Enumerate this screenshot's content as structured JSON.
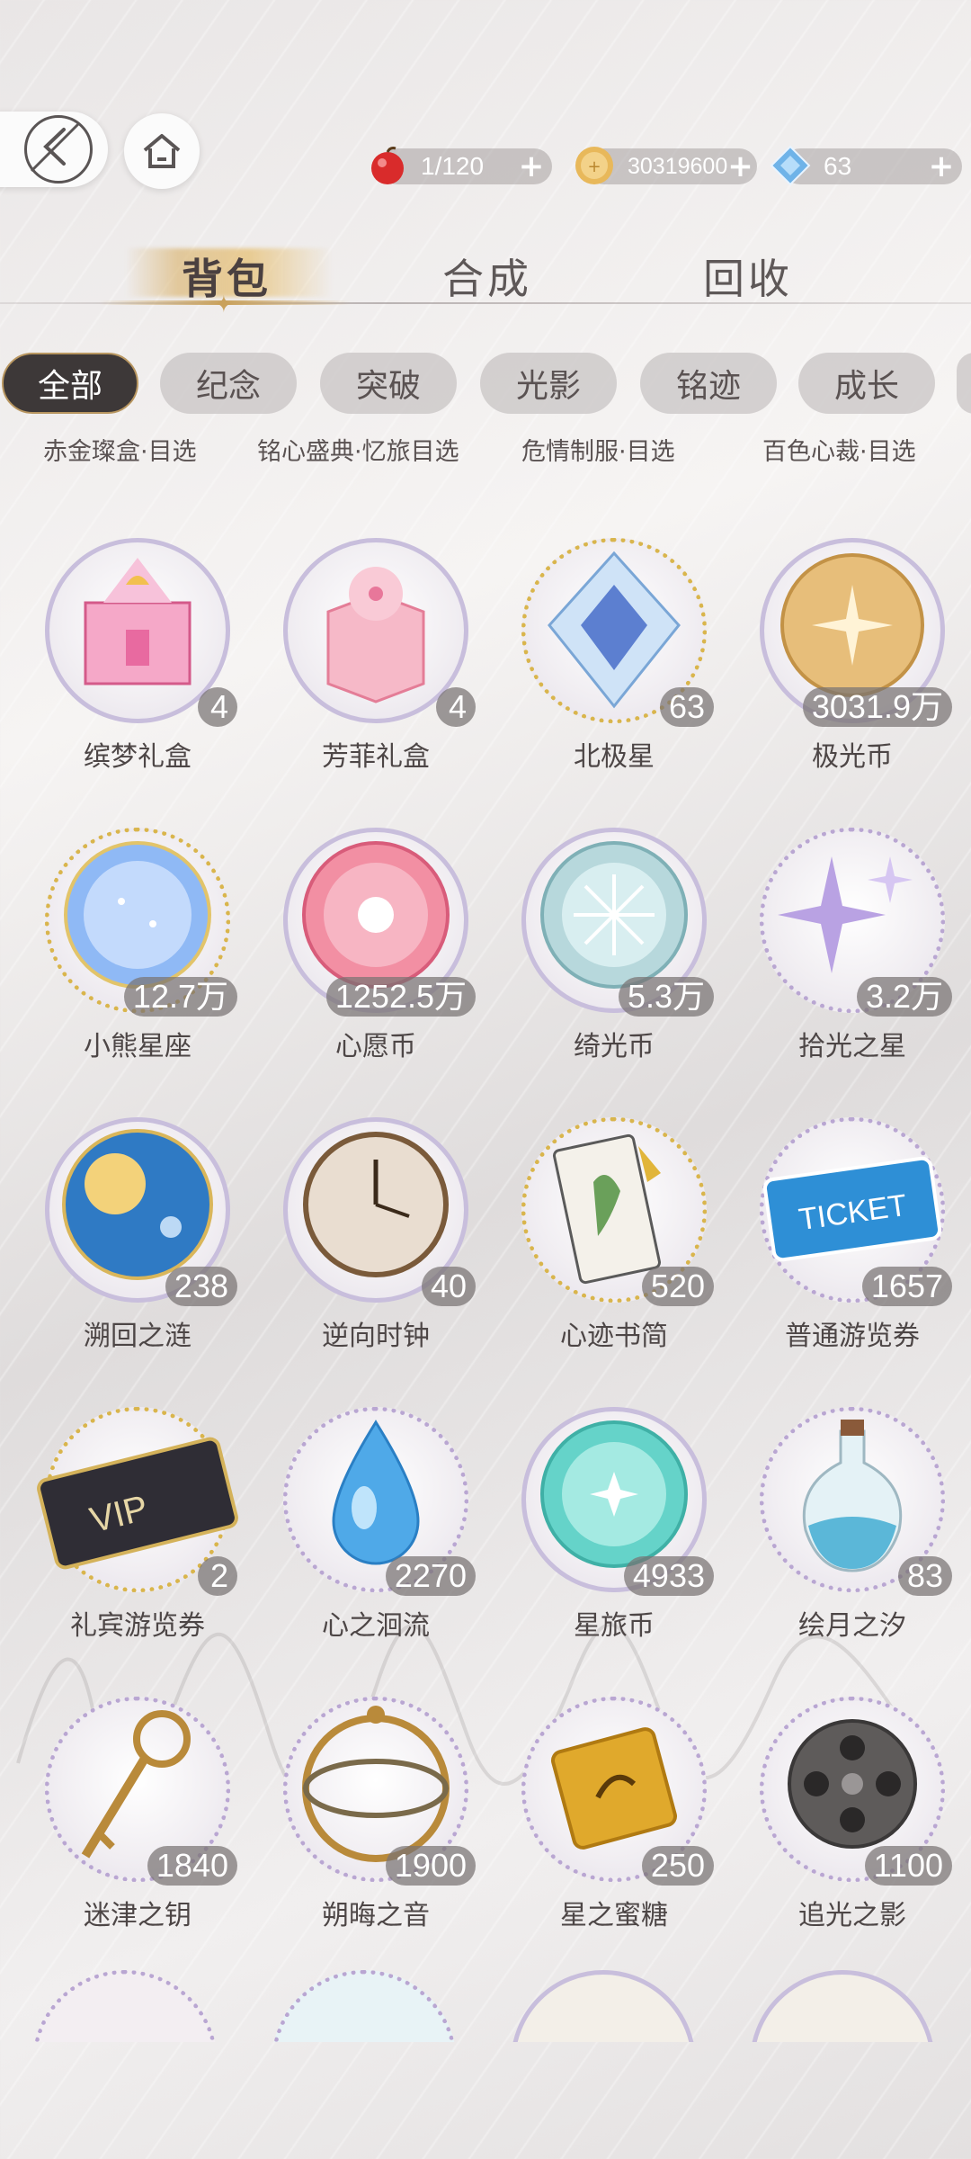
{
  "resources": {
    "stamina": {
      "value": "1/120",
      "icon": "red-apple-icon"
    },
    "coins": {
      "value": "30319600",
      "icon": "gold-coin-icon"
    },
    "gems": {
      "value": "63",
      "icon": "blue-diamond-icon"
    },
    "plus": "+"
  },
  "main_tabs": [
    "背包",
    "合成",
    "回收"
  ],
  "filter_chips": [
    "全部",
    "纪念",
    "突破",
    "光影",
    "铭迹",
    "成长"
  ],
  "subtitles": [
    "赤金璨盒·目选",
    "铭心盛典·忆旅目选",
    "危情制服·目选",
    "百色心裁·目选"
  ],
  "items": [
    {
      "name": "缤梦礼盒",
      "count": "4"
    },
    {
      "name": "芳菲礼盒",
      "count": "4"
    },
    {
      "name": "北极星",
      "count": "63"
    },
    {
      "name": "极光币",
      "count": "3031.9万"
    },
    {
      "name": "小熊星座",
      "count": "12.7万"
    },
    {
      "name": "心愿币",
      "count": "1252.5万"
    },
    {
      "name": "绮光币",
      "count": "5.3万"
    },
    {
      "name": "拾光之星",
      "count": "3.2万"
    },
    {
      "name": "溯回之涟",
      "count": "238"
    },
    {
      "name": "逆向时钟",
      "count": "40"
    },
    {
      "name": "心迹书简",
      "count": "520"
    },
    {
      "name": "普通游览券",
      "count": "1657"
    },
    {
      "name": "礼宾游览券",
      "count": "2"
    },
    {
      "name": "心之洄流",
      "count": "2270"
    },
    {
      "name": "星旅币",
      "count": "4933"
    },
    {
      "name": "绘月之汐",
      "count": "83"
    },
    {
      "name": "迷津之钥",
      "count": "1840"
    },
    {
      "name": "朔晦之音",
      "count": "1900"
    },
    {
      "name": "星之蜜糖",
      "count": "250"
    },
    {
      "name": "追光之影",
      "count": "1100"
    }
  ],
  "colors": {
    "accent_gold": "#c9a15c",
    "chip_active": "#3d3838"
  }
}
